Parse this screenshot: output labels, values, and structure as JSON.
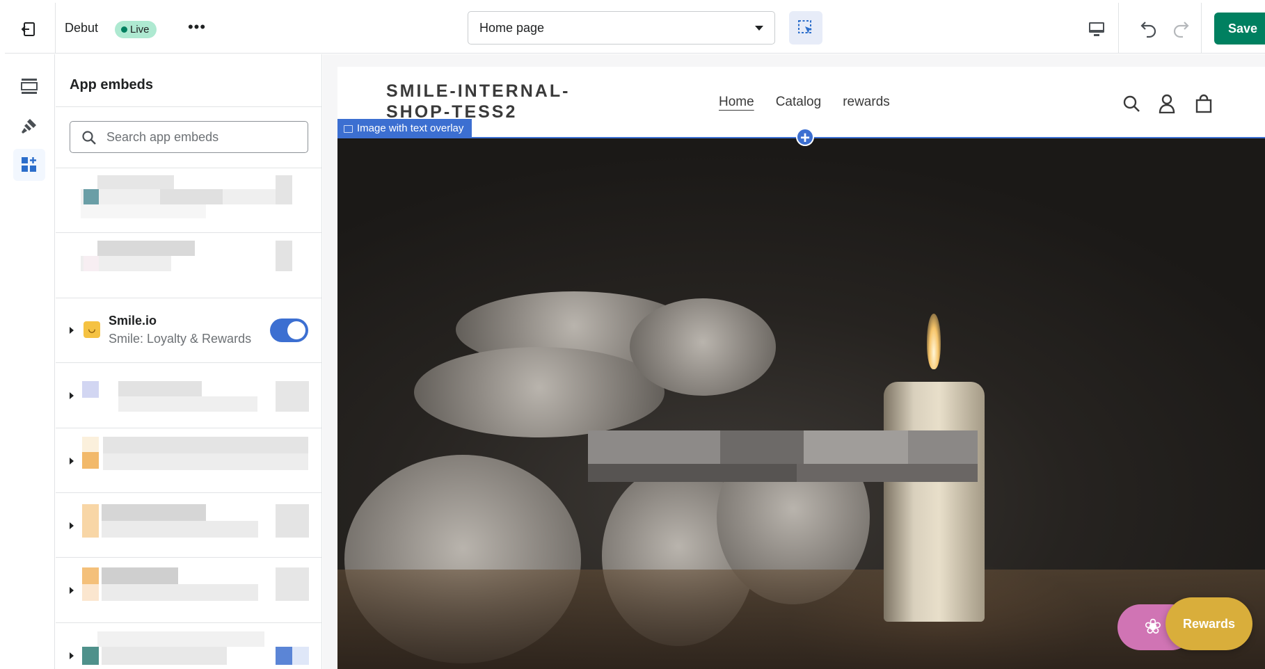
{
  "topbar": {
    "theme_name": "Debut",
    "live_badge": "Live",
    "more_label": "•••",
    "page_selector_value": "Home page",
    "save_label": "Save",
    "icons": [
      "exit-icon",
      "inspector-select-icon",
      "desktop-icon",
      "undo-icon",
      "redo-icon"
    ]
  },
  "rail": {
    "items": [
      {
        "name": "sections",
        "icon": "sections-icon"
      },
      {
        "name": "theme-settings",
        "icon": "brush-icon"
      },
      {
        "name": "app-embeds",
        "icon": "apps-add-icon",
        "active": true
      }
    ]
  },
  "panel": {
    "title": "App embeds",
    "search_placeholder": "Search app embeds",
    "apps": [
      {
        "name": "Smile.io",
        "subtitle": "Smile: Loyalty & Rewards",
        "enabled": true
      }
    ]
  },
  "preview": {
    "store_name": "SMILE-INTERNAL-SHOP-TESS2",
    "nav": [
      "Home",
      "Catalog",
      "rewards"
    ],
    "section_label": "Image with text overlay",
    "rewards_label": "Rewards",
    "accent": "#3c6fd1",
    "save_color": "#008060"
  }
}
